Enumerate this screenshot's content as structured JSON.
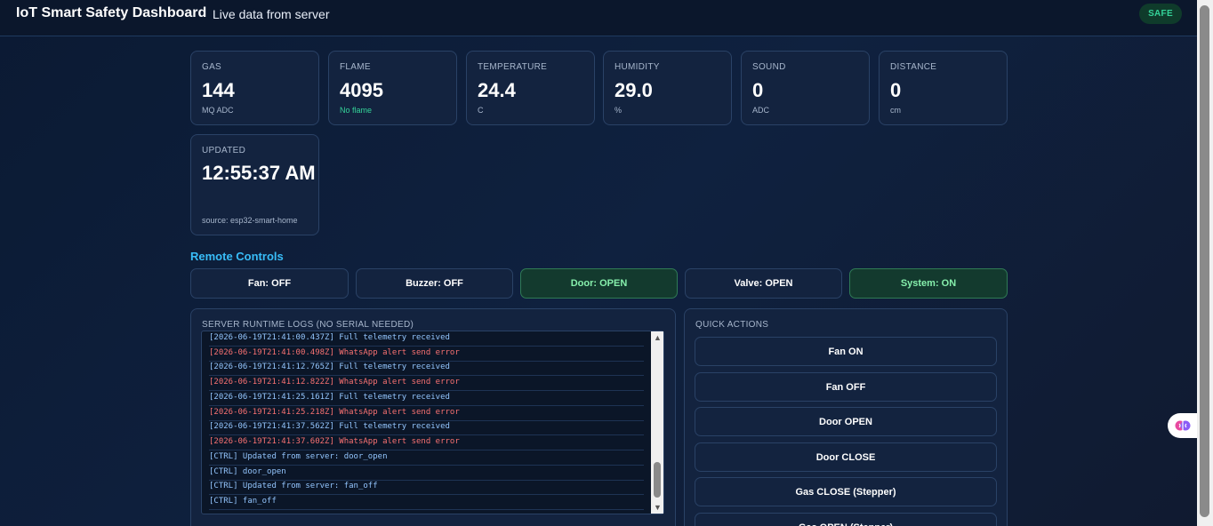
{
  "header": {
    "title": "IoT Smart Safety Dashboard",
    "subtitle": "Live data from server",
    "status": "SAFE"
  },
  "sensors": [
    {
      "label": "GAS",
      "value": "144",
      "unit": "MQ ADC"
    },
    {
      "label": "FLAME",
      "value": "4095",
      "unit": "No flame"
    },
    {
      "label": "TEMPERATURE",
      "value": "24.4",
      "unit": "C"
    },
    {
      "label": "HUMIDITY",
      "value": "29.0",
      "unit": "%"
    },
    {
      "label": "SOUND",
      "value": "0",
      "unit": "ADC"
    },
    {
      "label": "DISTANCE",
      "value": "0",
      "unit": "cm"
    }
  ],
  "updated": {
    "label": "UPDATED",
    "value": "12:55:37 AM",
    "source": "source: esp32-smart-home"
  },
  "controls": {
    "title": "Remote Controls",
    "buttons": [
      {
        "label": "Fan: OFF",
        "state": "off"
      },
      {
        "label": "Buzzer: OFF",
        "state": "off"
      },
      {
        "label": "Door: OPEN",
        "state": "on"
      },
      {
        "label": "Valve: OPEN",
        "state": "off"
      },
      {
        "label": "System: ON",
        "state": "on"
      }
    ]
  },
  "logs": {
    "title": "SERVER RUNTIME LOGS (NO SERIAL NEEDED)",
    "lines": [
      {
        "text": "[2026-06-19T21:41:00.437Z] Full telemetry received",
        "level": "info"
      },
      {
        "text": "[2026-06-19T21:41:00.498Z] WhatsApp alert send error",
        "level": "err"
      },
      {
        "text": "[2026-06-19T21:41:12.765Z] Full telemetry received",
        "level": "info"
      },
      {
        "text": "[2026-06-19T21:41:12.822Z] WhatsApp alert send error",
        "level": "err"
      },
      {
        "text": "[2026-06-19T21:41:25.161Z] Full telemetry received",
        "level": "info"
      },
      {
        "text": "[2026-06-19T21:41:25.218Z] WhatsApp alert send error",
        "level": "err"
      },
      {
        "text": "[2026-06-19T21:41:37.562Z] Full telemetry received",
        "level": "info"
      },
      {
        "text": "[2026-06-19T21:41:37.602Z] WhatsApp alert send error",
        "level": "err"
      },
      {
        "text": "[CTRL] Updated from server: door_open",
        "level": "ctrl"
      },
      {
        "text": "[CTRL] door_open",
        "level": "ctrl"
      },
      {
        "text": "[CTRL] Updated from server: fan_off",
        "level": "ctrl"
      },
      {
        "text": "[CTRL] fan_off",
        "level": "ctrl"
      }
    ]
  },
  "quick_actions": {
    "title": "QUICK ACTIONS",
    "buttons": [
      "Fan ON",
      "Fan OFF",
      "Door OPEN",
      "Door CLOSE",
      "Gas CLOSE (Stepper)",
      "Gas OPEN (Stepper)"
    ]
  },
  "colors": {
    "accent": "#38bdf8",
    "safe": "#34d399",
    "error": "#f87171",
    "info": "#93c5fd"
  }
}
